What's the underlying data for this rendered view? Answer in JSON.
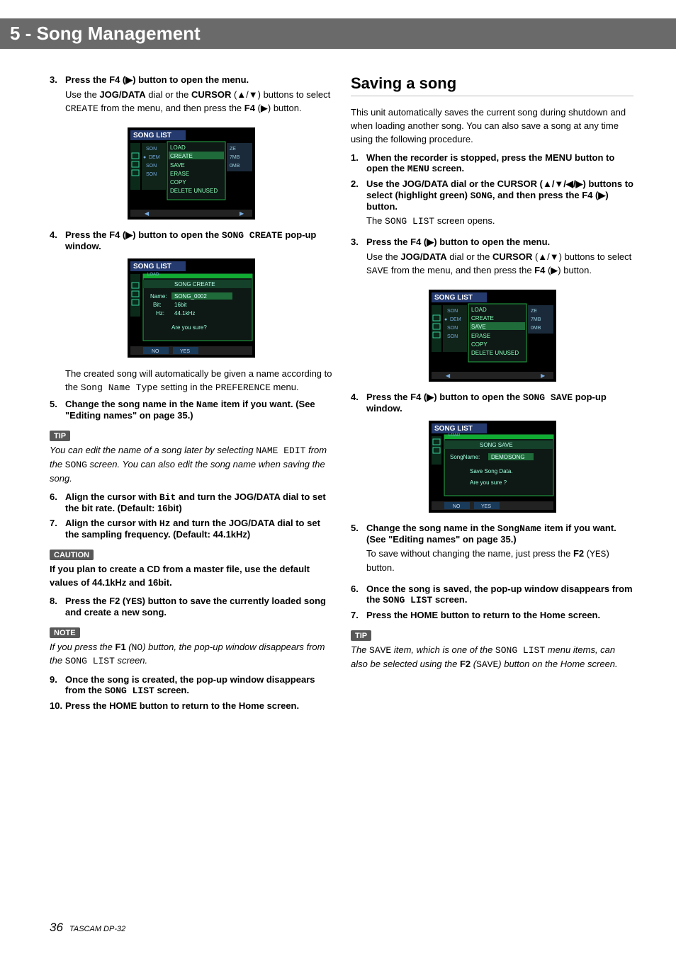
{
  "header": {
    "chapter": "5 - Song Management"
  },
  "section2": {
    "title": "Saving a song",
    "intro": "This unit automatically saves the current song during shutdown and when loading another song. You can also save a song at any time using the following procedure."
  },
  "left": {
    "s3": {
      "num": "3.",
      "head": "Press the F4 (▶) button to open the menu.",
      "body_a": "Use the ",
      "body_jog": "JOG/DATA",
      "body_b": " dial or the ",
      "body_cur": "CURSOR",
      "body_c": " (▲/▼) buttons to select ",
      "body_lcd": "CREATE",
      "body_d": " from the menu, and then press the ",
      "body_f4": "F4",
      "body_e": " (▶) button."
    },
    "s4": {
      "num": "4.",
      "head_a": "Press the F4 (▶) button to open the ",
      "head_lcd": "SONG CREATE",
      "head_b": " pop-up window.",
      "body_a": "The created song will automatically be given a name according to the ",
      "body_lcd1": "Song Name Type",
      "body_b": " setting in the ",
      "body_lcd2": "PREFERENCE",
      "body_c": " menu."
    },
    "s5": {
      "num": "5.",
      "head_a": "Change the song name in the ",
      "head_lcd": "Name",
      "head_b": " item if you want. (See \"Editing names\" on page 35.)"
    },
    "tip1": {
      "label": "TIP",
      "body_a": "You can edit the name of a song later by selecting ",
      "lcd1": "NAME EDIT",
      "body_b": " from the ",
      "lcd2": "SONG",
      "body_c": " screen. You can also edit the song name when saving the song."
    },
    "s6": {
      "num": "6.",
      "head_a": "Align the cursor with ",
      "head_lcd": "Bit",
      "head_b": " and turn the JOG/DATA dial to set the bit rate. (Default: 16bit)"
    },
    "s7": {
      "num": "7.",
      "head_a": "Align the cursor with ",
      "head_lcd": "Hz",
      "head_b": " and turn the JOG/DATA dial to set the sampling frequency. (Default: 44.1kHz)"
    },
    "caution": {
      "label": "CAUTION",
      "body": "If you plan to create a CD from a master file, use the default values of 44.1kHz and 16bit."
    },
    "s8": {
      "num": "8.",
      "head_a": "Press the F2 (",
      "head_lcd": "YES",
      "head_b": ") button to save the currently loaded song and create a new song."
    },
    "note": {
      "label": "NOTE",
      "body_a": "If you press the ",
      "f1": "F1",
      "body_b": " (",
      "lcd1": "NO",
      "body_c": ") button, the pop-up window disappears from the ",
      "lcd2": "SONG LIST",
      "body_d": " screen."
    },
    "s9": {
      "num": "9.",
      "head_a": "Once the song is created, the pop-up window disappears from the ",
      "head_lcd": "SONG LIST",
      "head_b": " screen."
    },
    "s10": {
      "num": "10.",
      "head": "Press the HOME button to return to the Home screen."
    }
  },
  "right": {
    "s1": {
      "num": "1.",
      "head_a": "When the recorder is stopped, press the MENU button to open the ",
      "head_lcd": "MENU",
      "head_b": " screen."
    },
    "s2": {
      "num": "2.",
      "head_a": "Use the JOG/DATA dial or the CURSOR (▲/▼/◀/▶) buttons to select (highlight green) ",
      "head_lcd": "SONG",
      "head_b": ", and then press the F4 (▶) button.",
      "body_a": "The ",
      "body_lcd": "SONG LIST",
      "body_b": " screen opens."
    },
    "s3": {
      "num": "3.",
      "head": "Press the F4 (▶) button to open the menu.",
      "body_a": "Use the ",
      "body_jog": "JOG/DATA",
      "body_b": " dial or the ",
      "body_cur": "CURSOR",
      "body_c": " (▲/▼) buttons to select ",
      "body_lcd": "SAVE",
      "body_d": " from the menu, and then press the ",
      "body_f4": "F4",
      "body_e": " (▶) button."
    },
    "s4": {
      "num": "4.",
      "head_a": "Press the F4 (▶) button to open the ",
      "head_lcd": "SONG SAVE",
      "head_b": " pop-up window."
    },
    "s5": {
      "num": "5.",
      "head_a": "Change the song name in the ",
      "head_lcd": "SongName",
      "head_b": " item if you want. (See \"Editing names\" on page 35.)",
      "body_a": "To save without changing the name, just press the ",
      "body_f2": "F2",
      "body_b": " (",
      "body_lcd": "YES",
      "body_c": ") button."
    },
    "s6": {
      "num": "6.",
      "head_a": "Once the song is saved, the pop-up window disappears from the ",
      "head_lcd": "SONG LIST",
      "head_b": " screen."
    },
    "s7": {
      "num": "7.",
      "head": "Press the HOME button to return to the Home screen."
    },
    "tip": {
      "label": "TIP",
      "body_a": "The ",
      "lcd1": "SAVE",
      "body_b": " item, which is one of the ",
      "lcd2": "SONG LIST",
      "body_c": " menu items, can also be selected using the ",
      "f2": "F2",
      "body_d": " (",
      "lcd3": "SAVE",
      "body_e": ") button on the Home screen."
    }
  },
  "lcd_menu": {
    "title": "SONG LIST",
    "items": [
      "LOAD",
      "CREATE",
      "SAVE",
      "ERASE",
      "COPY",
      "DELETE UNUSED"
    ],
    "badges": [
      "ZE",
      "7MB",
      "0MB"
    ],
    "rows": [
      "SON",
      "DEM",
      "SON",
      "SON"
    ]
  },
  "lcd_create": {
    "title": "SONG LIST",
    "popup": "SONG CREATE",
    "name_lbl": "Name:",
    "name_val": "SONG_0002",
    "bit_lbl": "Bit:",
    "bit_val": "16bit",
    "hz_lbl": "Hz:",
    "hz_val": "44.1kHz",
    "prompt": "Are you sure?",
    "no": "NO",
    "yes": "YES"
  },
  "lcd_save": {
    "title": "SONG LIST",
    "popup": "SONG SAVE",
    "name_lbl": "SongName:",
    "name_val": "DEMOSONG",
    "line": "Save Song Data.",
    "prompt": "Are you sure ?",
    "no": "NO",
    "yes": "YES"
  },
  "footer": {
    "page": "36",
    "model": "TASCAM DP-32"
  }
}
